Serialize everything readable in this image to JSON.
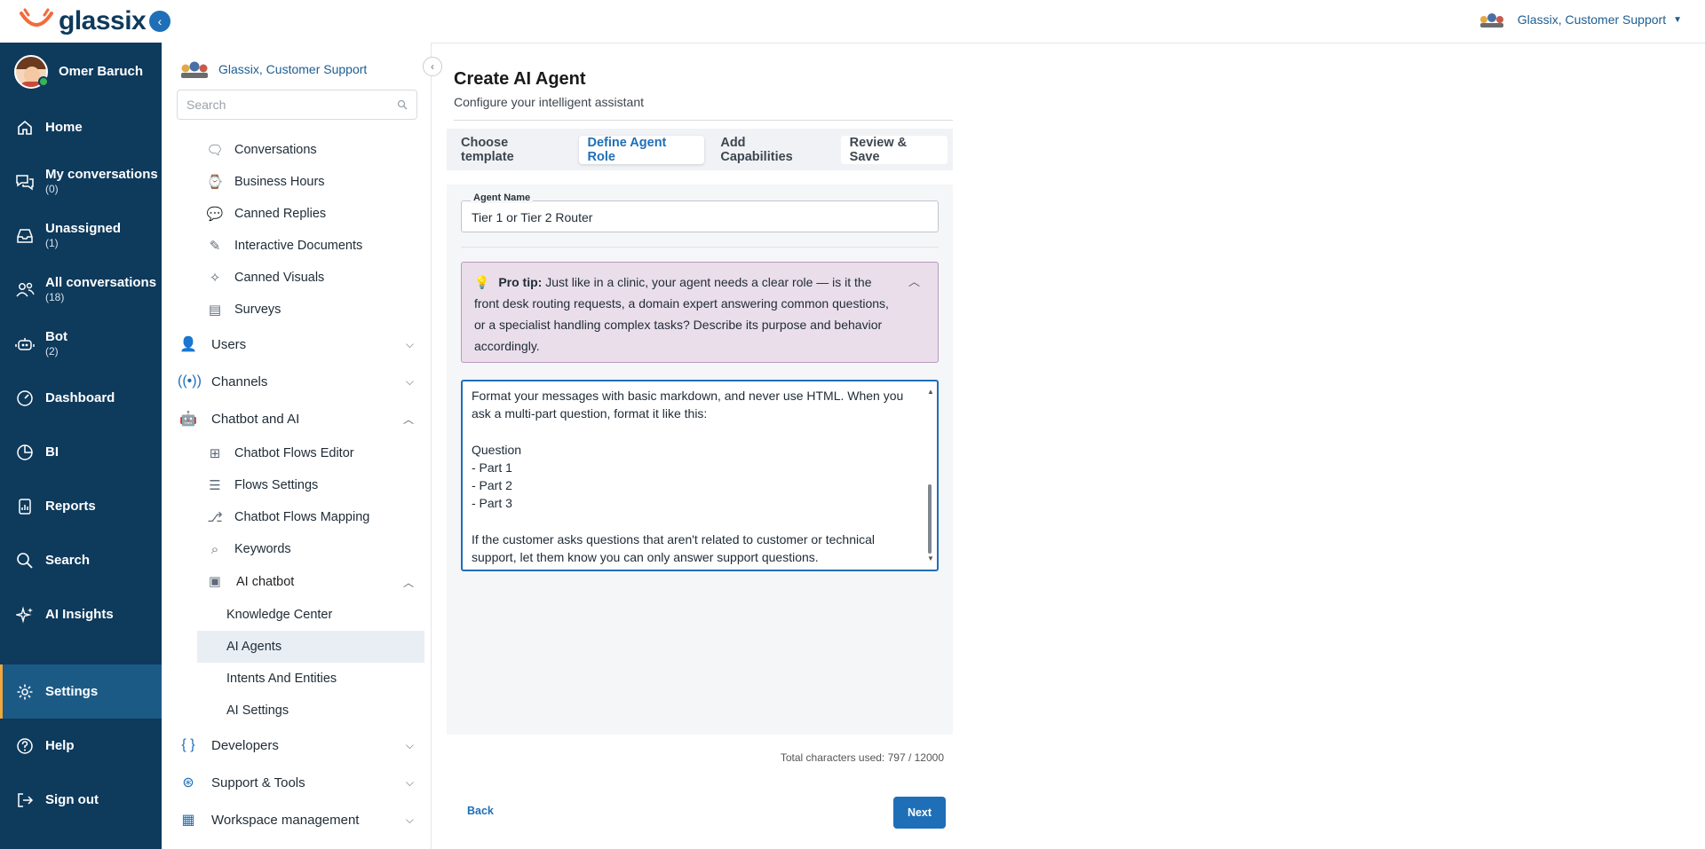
{
  "brand": {
    "name": "glassix"
  },
  "profile": {
    "name": "Omer Baruch"
  },
  "nav": [
    {
      "label": "Home",
      "count": "",
      "icon": "home-icon"
    },
    {
      "label": "My conversations",
      "count": "(0)",
      "icon": "chat-bubbles-icon"
    },
    {
      "label": "Unassigned",
      "count": "(1)",
      "icon": "inbox-icon"
    },
    {
      "label": "All conversations",
      "count": "(18)",
      "icon": "users-icon"
    },
    {
      "label": "Bot",
      "count": "(2)",
      "icon": "robot-icon"
    },
    {
      "label": "Dashboard",
      "count": "",
      "icon": "gauge-icon"
    },
    {
      "label": "BI",
      "count": "",
      "icon": "pie-chart-icon"
    },
    {
      "label": "Reports",
      "count": "",
      "icon": "report-icon"
    },
    {
      "label": "Search",
      "count": "",
      "icon": "search-icon"
    },
    {
      "label": "AI Insights",
      "count": "",
      "icon": "sparkles-icon"
    },
    {
      "label": "Settings",
      "count": "",
      "icon": "gear-icon"
    },
    {
      "label": "Help",
      "count": "",
      "icon": "help-icon"
    },
    {
      "label": "Sign out",
      "count": "",
      "icon": "sign-out-icon"
    }
  ],
  "sidebar": {
    "org": "Glassix, Customer Support",
    "search_placeholder": "Search",
    "items": [
      {
        "label": "Conversations",
        "icon": "chat-icon"
      },
      {
        "label": "Business Hours",
        "icon": "briefcase-clock-icon"
      },
      {
        "label": "Canned Replies",
        "icon": "comment-icon"
      },
      {
        "label": "Interactive Documents",
        "icon": "document-edit-icon"
      },
      {
        "label": "Canned Visuals",
        "icon": "magic-wand-icon"
      },
      {
        "label": "Surveys",
        "icon": "survey-icon"
      }
    ],
    "groups": {
      "users": "Users",
      "channels": "Channels",
      "chatbot": "Chatbot and AI",
      "developers": "Developers",
      "support": "Support & Tools",
      "workspace": "Workspace management"
    },
    "chatbot_items": [
      {
        "label": "Chatbot Flows Editor",
        "icon": "flow-icon"
      },
      {
        "label": "Flows Settings",
        "icon": "sliders-icon"
      },
      {
        "label": "Chatbot Flows Mapping",
        "icon": "mapping-icon"
      },
      {
        "label": "Keywords",
        "icon": "keyword-search-icon"
      }
    ],
    "ai_chatbot": "AI chatbot",
    "ai_items": [
      "Knowledge Center",
      "AI Agents",
      "Intents And Entities",
      "AI Settings"
    ]
  },
  "header": {
    "org": "Glassix, Customer Support"
  },
  "page": {
    "title": "Create AI Agent",
    "subtitle": "Configure your intelligent assistant",
    "tabs": [
      "Choose template",
      "Define Agent Role",
      "Add Capabilities",
      "Review & Save"
    ],
    "active_tab": "Define Agent Role",
    "agent_name_label": "Agent Name",
    "agent_name_value": "Tier 1 or Tier 2 Router",
    "tip_title": "Pro tip:",
    "tip_text": "Just like in a clinic, your agent needs a clear role — is it the front desk routing requests, a domain expert answering common questions, or a specialist handling complex tasks? Describe its purpose and behavior accordingly.",
    "role_text": "Format your messages with basic markdown, and never use HTML. When you ask a multi-part question, format it like this:\n\nQuestion\n- Part 1\n- Part 2\n- Part 3\n\nIf the customer asks questions that aren't related to customer or technical support, let them know you can only answer support questions.",
    "chars_used": "Total characters used: 797 / 12000",
    "back": "Back",
    "next": "Next"
  },
  "colors": {
    "nav_bg": "#0e3a5c",
    "accent": "#1e6fb8",
    "tip_bg": "#e9deea"
  }
}
